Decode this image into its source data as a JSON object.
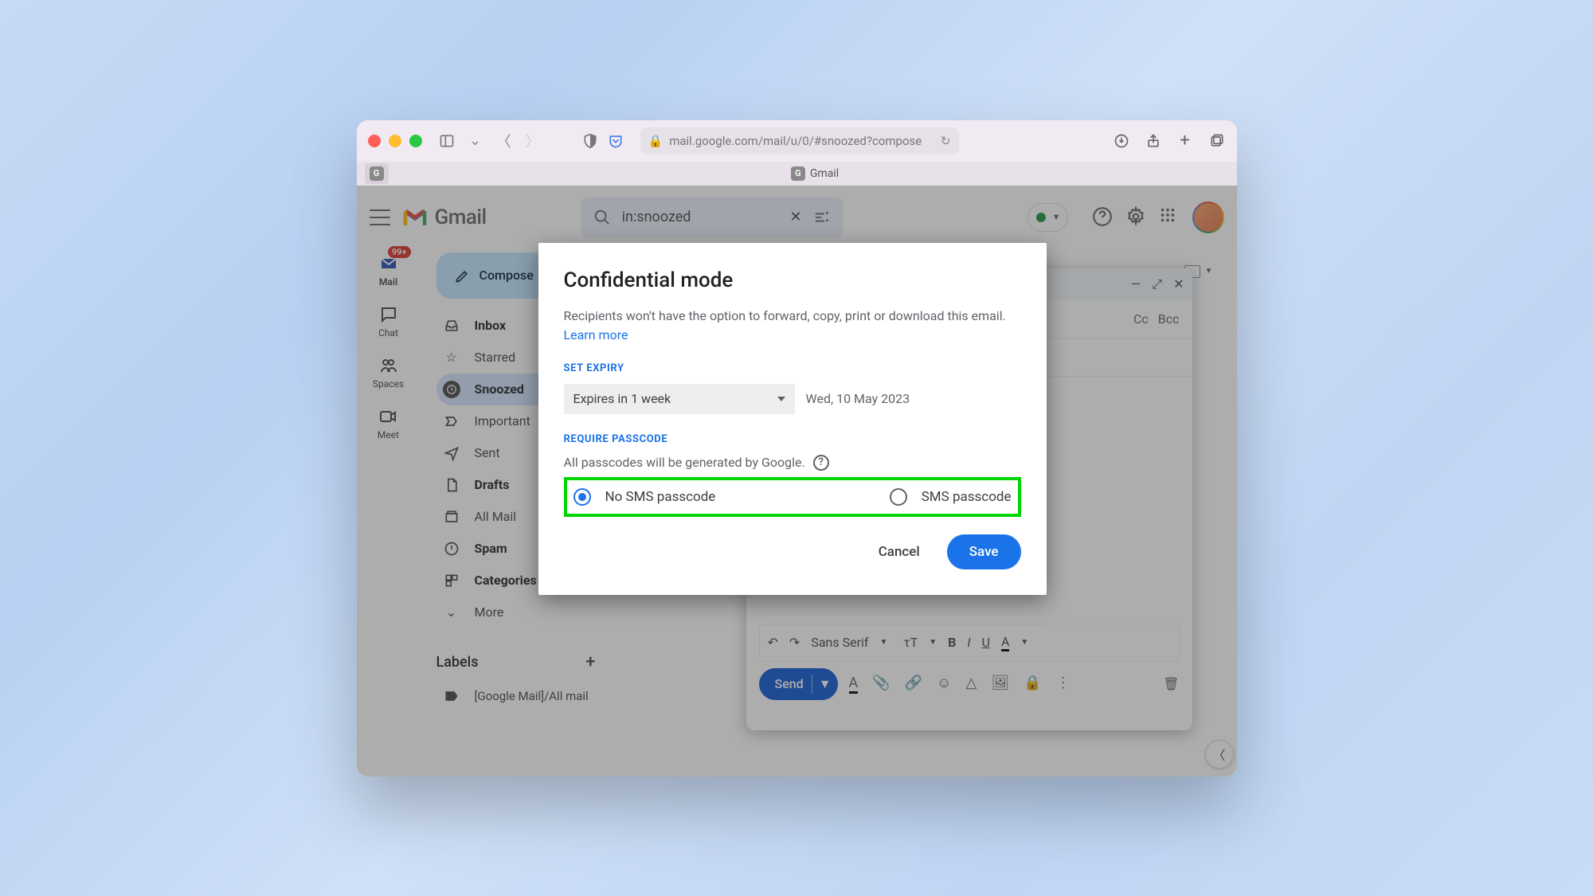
{
  "browser": {
    "url": "mail.google.com/mail/u/0/#snoozed?compose",
    "tab_badge": "G",
    "tab_label": "Gmail"
  },
  "header": {
    "brand": "Gmail",
    "search_value": "in:snoozed"
  },
  "rail": {
    "mail": "Mail",
    "chat": "Chat",
    "spaces": "Spaces",
    "meet": "Meet",
    "badge": "99+"
  },
  "sidebar": {
    "compose": "Compose",
    "folders": [
      {
        "label": "Inbox",
        "bold": true
      },
      {
        "label": "Starred"
      },
      {
        "label": "Snoozed",
        "active": true
      },
      {
        "label": "Important"
      },
      {
        "label": "Sent"
      },
      {
        "label": "Drafts",
        "bold": true
      },
      {
        "label": "All Mail"
      },
      {
        "label": "Spam",
        "bold": true
      },
      {
        "label": "Categories",
        "bold": true
      },
      {
        "label": "More"
      }
    ],
    "labels_heading": "Labels",
    "label1": "[Google Mail]/All mail"
  },
  "compose": {
    "cc": "Cc",
    "bcc": "Bcc",
    "font": "Sans Serif",
    "send": "Send"
  },
  "modal": {
    "title": "Confidential mode",
    "desc": "Recipients won't have the option to forward, copy, print or download this email. ",
    "learn": "Learn more",
    "set_expiry": "SET EXPIRY",
    "expiry_value": "Expires in 1 week",
    "expiry_date": "Wed, 10 May 2023",
    "require_passcode": "REQUIRE PASSCODE",
    "passcode_desc": "All passcodes will be generated by Google.",
    "opt_no_sms": "No SMS passcode",
    "opt_sms": "SMS passcode",
    "cancel": "Cancel",
    "save": "Save"
  }
}
